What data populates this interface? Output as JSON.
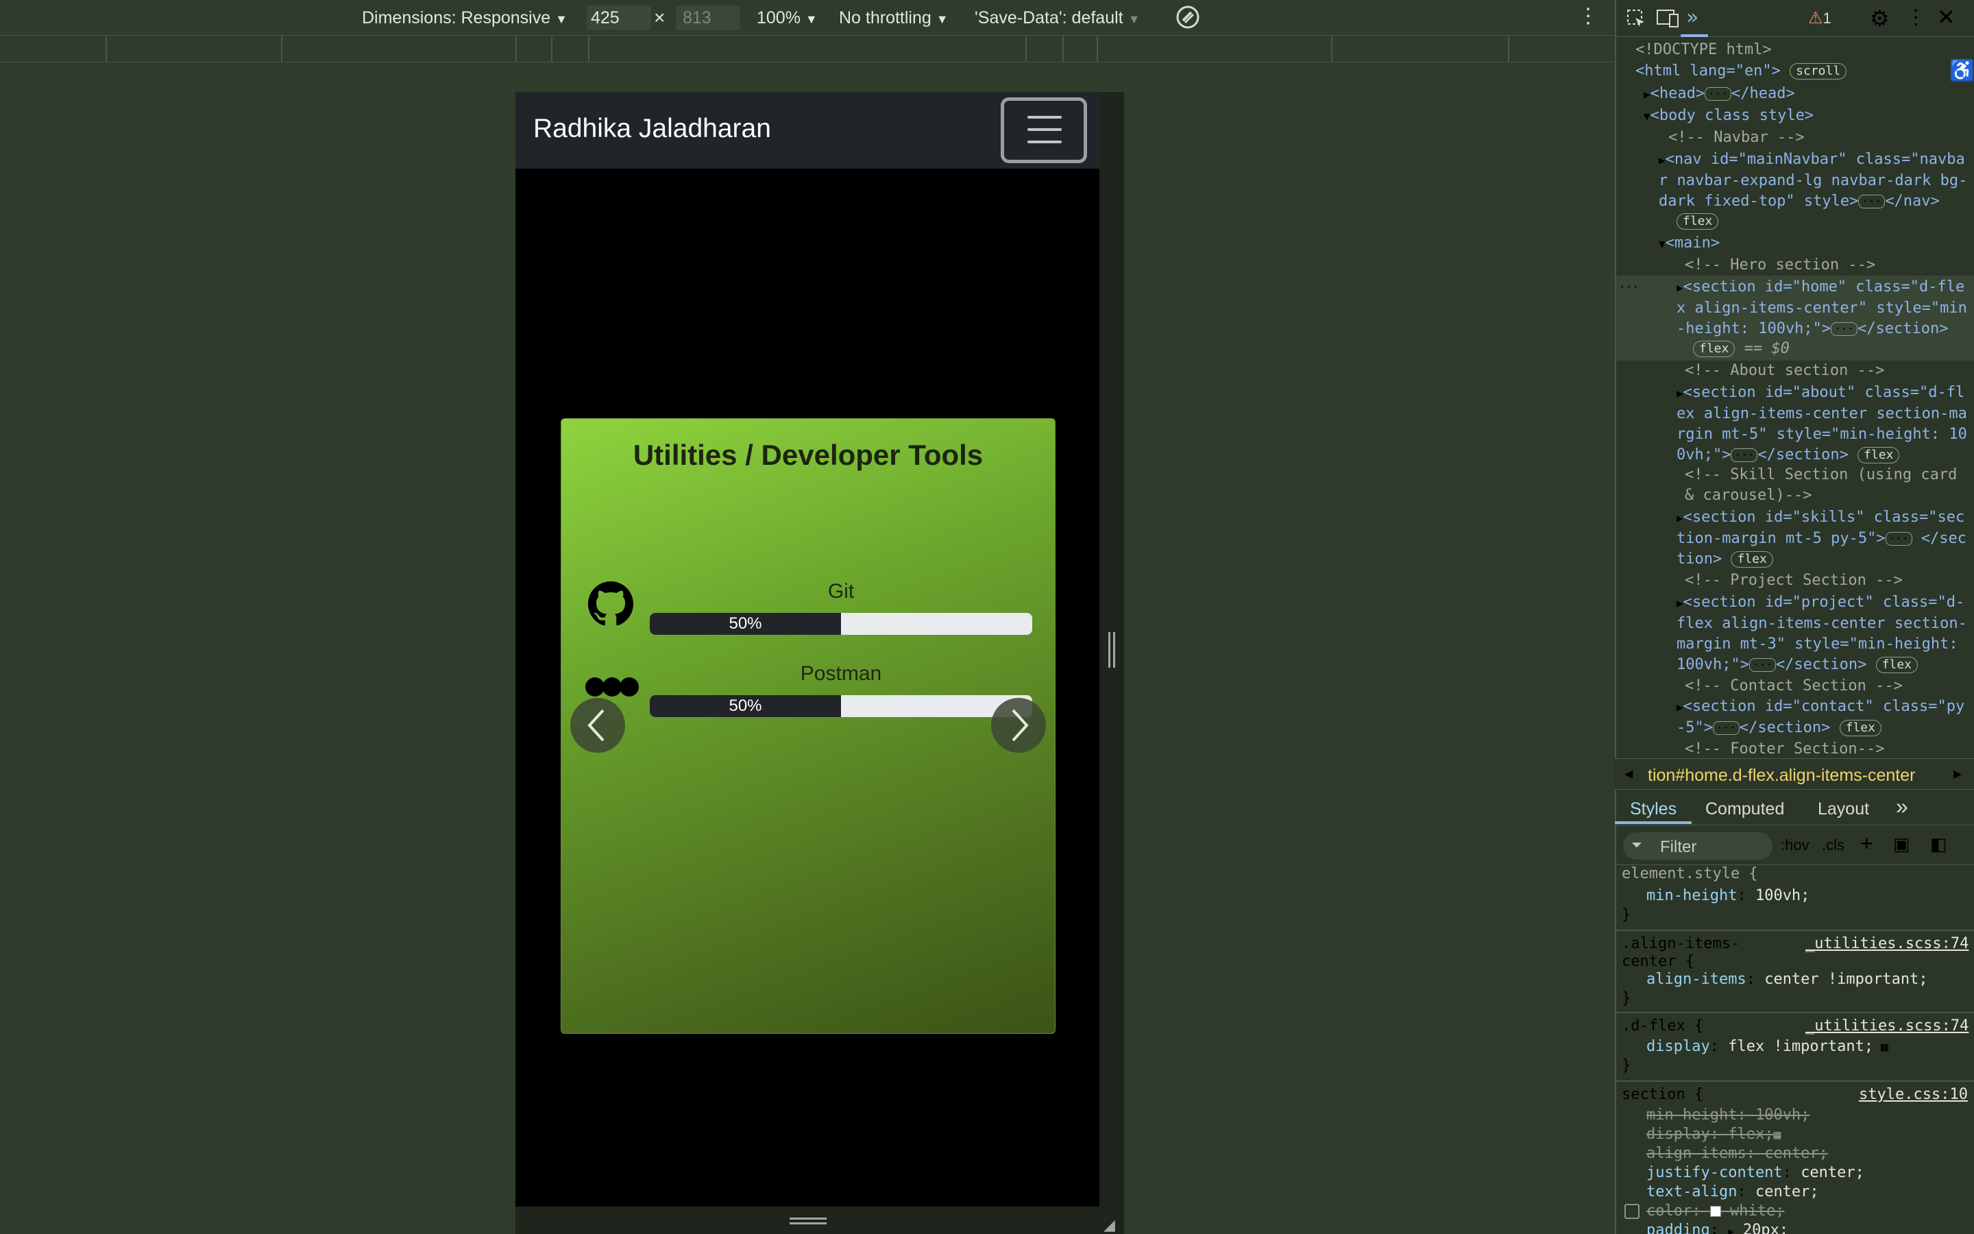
{
  "device_toolbar": {
    "dimensions_label": "Dimensions: Responsive",
    "width": "425",
    "times": "×",
    "height": "813",
    "zoom": "100%",
    "throttling": "No throttling",
    "save_data": "'Save-Data': default"
  },
  "site": {
    "brand": "Radhika Jaladharan",
    "card_title": "Utilities / Developer Tools",
    "skills": [
      {
        "name": "Git",
        "percent_label": "50%",
        "percent": 50,
        "icon": "github-icon"
      },
      {
        "name": "Postman",
        "percent_label": "50%",
        "percent": 50,
        "icon": "postman-icon"
      }
    ]
  },
  "devtools": {
    "warning_count": "1",
    "dom_lines": [
      "<!DOCTYPE html>",
      "<html lang=\"en\">",
      "scroll",
      "<head>",
      "</head>",
      "<body class style>",
      "<!-- Navbar -->",
      "<nav id=\"mainNavbar\" class=\"navbar navbar-expand-lg navbar-dark bg-dark fixed-top\" style>",
      "</nav>",
      "flex",
      "<main>",
      "<!-- Hero section -->",
      "<section id=\"home\" class=\"d-flex align-items-center\" style=\"min-height: 100vh;\">",
      "</section>",
      "== $0",
      "<!-- About section -->",
      "<section id=\"about\" class=\"d-flex align-items-center section-margin mt-5\" style=\"min-height: 100vh;\">",
      "<!-- Skill Section  (using card & carousel)-->",
      "<section id=\"skills\" class=\"section-margin mt-5 py-5\">",
      "<!-- Project Section -->",
      "<section id=\"project\" class=\"d-flex align-items-center section-margin mt-3\" style=\"min-height: 100vh;\">",
      "<!-- Contact Section -->",
      "<section id=\"contact\" class=\"py-5\">",
      "<!-- Footer Section-->"
    ],
    "breadcrumb": "tion#home.d-flex.align-items-center",
    "tabs": [
      "Styles",
      "Computed",
      "Layout"
    ],
    "filter_placeholder": "Filter",
    "hov": ":hov",
    "cls": ".cls",
    "rules": {
      "element_style": {
        "selector": "element.style {",
        "prop": "min-height",
        "value": "100vh;"
      },
      "align_items": {
        "selector_a": ".align-items-",
        "selector_b": "center {",
        "source": "_utilities.scss:74",
        "prop": "align-items",
        "value": "center !important;"
      },
      "d_flex": {
        "selector": ".d-flex {",
        "source": "_utilities.scss:74",
        "prop": "display",
        "value": "flex !important;"
      },
      "section": {
        "selector": "section {",
        "source": "style.css:10",
        "props": [
          {
            "prop": "min-height",
            "value": "100vh;"
          },
          {
            "prop": "display",
            "value": "flex;"
          },
          {
            "prop": "align-items",
            "value": "center;"
          },
          {
            "prop": "justify-content",
            "value": "center;"
          },
          {
            "prop": "text-align",
            "value": "center;"
          },
          {
            "prop": "color",
            "value": "white;"
          },
          {
            "prop": "padding",
            "value": "20px;"
          }
        ]
      },
      "close_brace": "}"
    }
  },
  "colors": {
    "accent_green": "#8fd43e",
    "navbar": "#212529",
    "devtools_bg": "#2b3628"
  }
}
